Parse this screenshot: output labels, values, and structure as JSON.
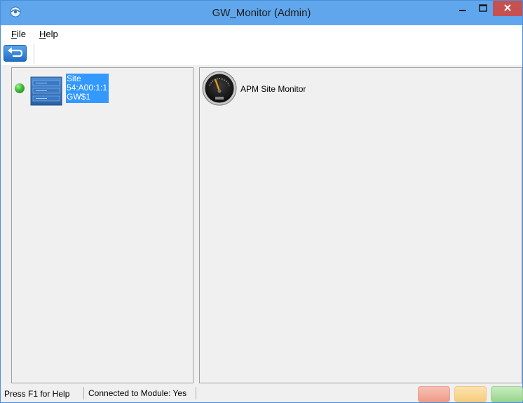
{
  "window": {
    "title": "GW_Monitor (Admin)",
    "colors": {
      "titlebar": "#5fa6ec",
      "close": "#c75050",
      "selection": "#3399ff"
    }
  },
  "menu": [
    {
      "label": "File",
      "accel": "F"
    },
    {
      "label": "Help",
      "accel": "H"
    }
  ],
  "toolbar": {
    "back_icon": "back-arrow-icon"
  },
  "tree": {
    "node": {
      "status": "online",
      "status_color": "#3cb93c",
      "icon": "server-rack-icon",
      "lines": [
        "Site",
        "54:A00:1:1",
        "GW$1"
      ]
    }
  },
  "modules": [
    {
      "label": "APM Site Monitor",
      "icon": "gauge-icon"
    }
  ],
  "statusbar": {
    "help": "Press F1 for Help",
    "connection": "Connected to Module: Yes",
    "indicators": [
      {
        "name": "red",
        "color": "#ef9c88"
      },
      {
        "name": "yellow",
        "color": "#f6cc7c"
      },
      {
        "name": "green",
        "color": "#98d48c"
      }
    ]
  }
}
